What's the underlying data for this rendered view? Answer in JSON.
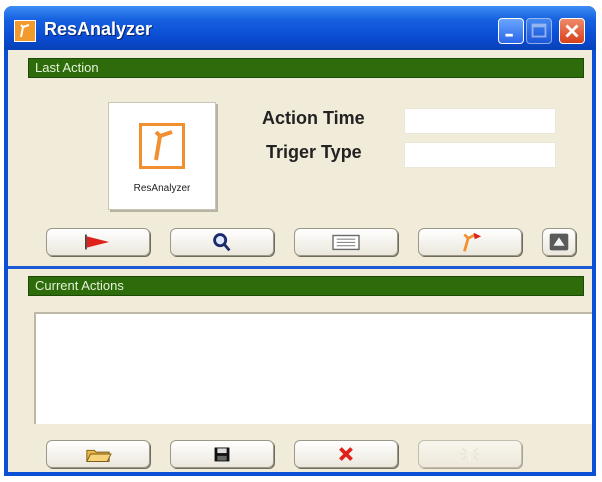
{
  "window": {
    "title": "ResAnalyzer",
    "icon": "resanalyzer-app-icon",
    "controls": [
      "minimize-icon",
      "maximize-icon",
      "close-icon"
    ]
  },
  "last_action": {
    "section_label": "Last Action",
    "logo_caption": "ResAnalyzer",
    "action_time_label": "Action Time",
    "action_time_value": "",
    "trigger_type_label": "Triger Type",
    "trigger_type_value": "",
    "toolbar": [
      {
        "name": "play-button",
        "icon": "red-flag-play-icon"
      },
      {
        "name": "search-button",
        "icon": "magnifier-icon"
      },
      {
        "name": "details-button",
        "icon": "list-icon"
      },
      {
        "name": "trigger-button",
        "icon": "trigger-flag-icon"
      },
      {
        "name": "collapse-button",
        "icon": "triangle-up-icon"
      }
    ]
  },
  "current_actions": {
    "section_label": "Current Actions",
    "items": [],
    "toolbar": [
      {
        "name": "open-button",
        "icon": "folder-open-icon"
      },
      {
        "name": "save-button",
        "icon": "floppy-disk-icon"
      },
      {
        "name": "delete-button",
        "icon": "red-x-icon"
      },
      {
        "name": "clear-button",
        "icon": "burst-icon",
        "disabled": true
      }
    ]
  },
  "colors": {
    "titlebar": "#0a4cd3",
    "section_bar": "#2e6b0a",
    "client_bg": "#f1ebd9",
    "accent_orange": "#f09030",
    "delete_red": "#e0201a"
  }
}
